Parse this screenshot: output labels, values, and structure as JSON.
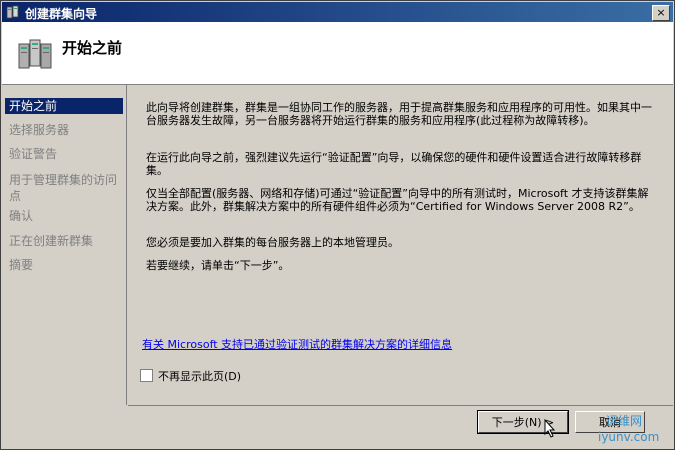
{
  "window": {
    "title": "创建群集向导",
    "close_glyph": "×"
  },
  "header": {
    "title": "开始之前",
    "icon": "cluster-servers-icon"
  },
  "nav": {
    "items": [
      {
        "label": "开始之前",
        "active": true
      },
      {
        "label": "选择服务器",
        "active": false
      },
      {
        "label": "验证警告",
        "active": false
      },
      {
        "label": "用于管理群集的访问点",
        "active": false
      },
      {
        "label": "确认",
        "active": false
      },
      {
        "label": "正在创建新群集",
        "active": false
      },
      {
        "label": "摘要",
        "active": false
      }
    ]
  },
  "content": {
    "paragraphs": [
      "此向导将创建群集，群集是一组协同工作的服务器，用于提高群集服务和应用程序的可用性。如果其中一台服务器发生故障，另一台服务器将开始运行群集的服务和应用程序(此过程称为故障转移)。",
      "在运行此向导之前，强烈建议先运行“验证配置”向导，以确保您的硬件和硬件设置适合进行故障转移群集。",
      "仅当全部配置(服务器、网络和存储)可通过“验证配置”向导中的所有测试时，Microsoft 才支持该群集解决方案。此外，群集解决方案中的所有硬件组件必须为“Certified for Windows Server 2008 R2”。",
      "您必须是要加入群集的每台服务器上的本地管理员。",
      "若要继续，请单击“下一步”。"
    ],
    "link": "有关 Microsoft 支持已通过验证测试的群集解决方案的详细信息",
    "checkbox_label": "不再显示此页(D)"
  },
  "buttons": {
    "next": "下一步(N) >",
    "cancel": "取消"
  },
  "watermark": {
    "line1": "运维网",
    "line2": "iyunv.com"
  }
}
